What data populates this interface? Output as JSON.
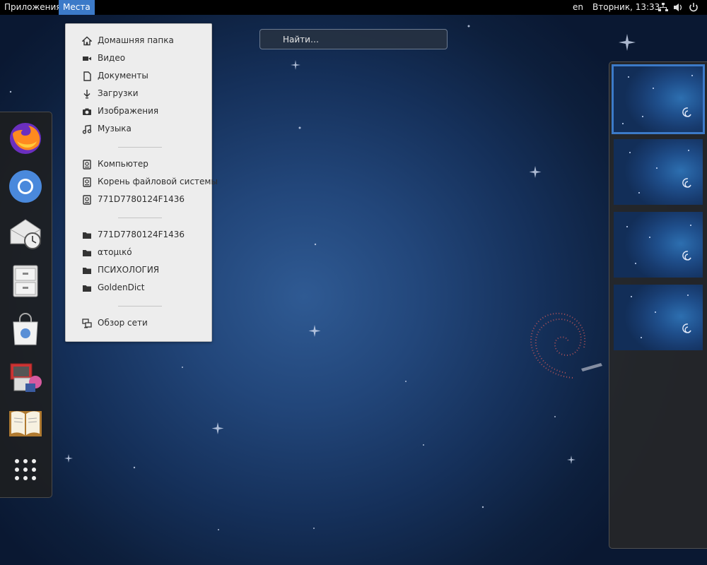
{
  "topbar": {
    "applications": "Приложения",
    "places": "Места",
    "language": "en",
    "clock": "Вторник, 13:33",
    "icons": [
      "network-icon",
      "volume-icon",
      "power-icon"
    ]
  },
  "search": {
    "placeholder": "Найти…"
  },
  "dash": {
    "apps": [
      "firefox-icon",
      "chromium-icon",
      "evolution-mail-icon",
      "file-cabinet-icon",
      "software-store-icon",
      "system-settings-icon",
      "dictionary-book-icon"
    ],
    "show_apps": "show-applications-icon"
  },
  "places_menu": {
    "groups": [
      [
        {
          "label": "Домашняя папка",
          "icon": "home-icon"
        },
        {
          "label": "Видео",
          "icon": "video-icon"
        },
        {
          "label": "Документы",
          "icon": "document-icon"
        },
        {
          "label": "Загрузки",
          "icon": "download-icon"
        },
        {
          "label": "Изображения",
          "icon": "camera-icon"
        },
        {
          "label": "Музыка",
          "icon": "music-icon"
        }
      ],
      [
        {
          "label": "Компьютер",
          "icon": "drive-icon"
        },
        {
          "label": "Корень файловой системы",
          "icon": "drive-icon"
        },
        {
          "label": "771D7780124F1436",
          "icon": "drive-icon"
        }
      ],
      [
        {
          "label": "771D7780124F1436",
          "icon": "folder-icon"
        },
        {
          "label": "ατομικό",
          "icon": "folder-icon"
        },
        {
          "label": "ПСИХОЛОГИЯ",
          "icon": "folder-icon"
        },
        {
          "label": "GoldenDict",
          "icon": "folder-icon"
        }
      ],
      [
        {
          "label": "Обзор сети",
          "icon": "network-browse-icon"
        }
      ]
    ]
  },
  "workspaces": {
    "count": 4,
    "active_index": 0
  },
  "colors": {
    "accent": "#3c7ac8",
    "topbar": "#000000",
    "menu_bg": "#ededed"
  }
}
